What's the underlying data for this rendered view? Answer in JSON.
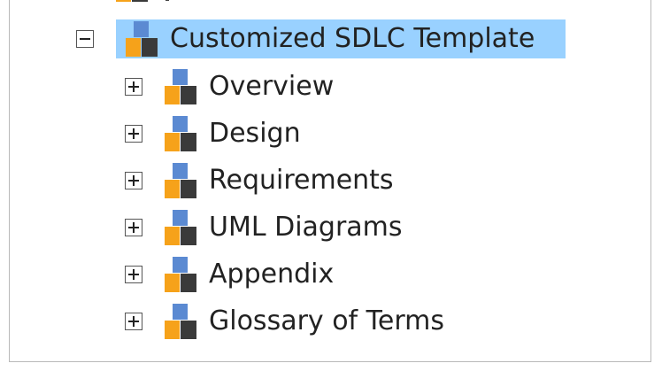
{
  "tree": {
    "root": {
      "label": "Customized SDLC Template",
      "expanded": true,
      "selected": true,
      "icon": "folder-blocks-icon"
    },
    "children": [
      {
        "label": "Overview",
        "expanded": false,
        "icon": "folder-blocks-icon"
      },
      {
        "label": "Design",
        "expanded": false,
        "icon": "folder-blocks-icon"
      },
      {
        "label": "Requirements",
        "expanded": false,
        "icon": "folder-blocks-icon"
      },
      {
        "label": "UML Diagrams",
        "expanded": false,
        "icon": "folder-blocks-icon"
      },
      {
        "label": "Appendix",
        "expanded": false,
        "icon": "folder-blocks-icon"
      },
      {
        "label": "Glossary of Terms",
        "expanded": false,
        "icon": "folder-blocks-icon"
      }
    ]
  },
  "colors": {
    "selection": "#99d1ff",
    "icon_blue": "#5b8ad2",
    "icon_orange": "#f6a21a",
    "icon_dark": "#3a3a3a"
  }
}
